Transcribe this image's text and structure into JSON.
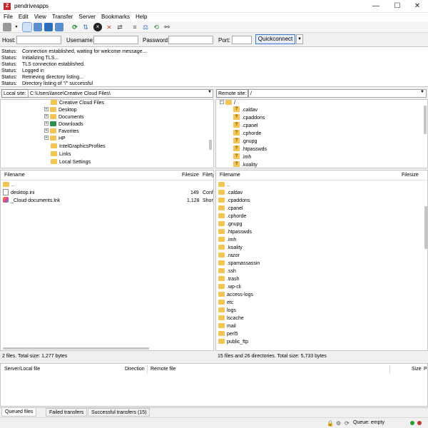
{
  "window": {
    "title": "pendriveapps",
    "app_icon": "filezilla-icon",
    "minimize": "—",
    "maximize": "☐",
    "close": "✕"
  },
  "menu": [
    "File",
    "Edit",
    "View",
    "Transfer",
    "Server",
    "Bookmarks",
    "Help"
  ],
  "toolbar": {
    "icons": [
      "site-manager-icon",
      "toggle-log-icon",
      "toggle-local-tree-icon",
      "toggle-remote-tree-icon",
      "toggle-queue-icon",
      "refresh-icon",
      "process-queue-icon",
      "cancel-icon",
      "disconnect-icon",
      "reconnect-icon",
      "directory-filter-icon",
      "compare-icon",
      "sync-browse-icon",
      "search-icon",
      "binoculars-icon"
    ]
  },
  "quickconnect": {
    "host_label": "Host:",
    "username_label": "Username:",
    "password_label": "Password:",
    "port_label": "Port:",
    "host_value": "",
    "username_value": "",
    "password_value": "",
    "port_value": "",
    "button_label": "Quickconnect",
    "dropdown": "▼"
  },
  "log": [
    {
      "key": "Status:",
      "text": "Connection established, waiting for welcome message..."
    },
    {
      "key": "Status:",
      "text": "Initializing TLS..."
    },
    {
      "key": "Status:",
      "text": "TLS connection established."
    },
    {
      "key": "Status:",
      "text": "Logged in"
    },
    {
      "key": "Status:",
      "text": "Retrieving directory listing..."
    },
    {
      "key": "Status:",
      "text": "Directory listing of \"/\" successful"
    }
  ],
  "local_site": {
    "label": "Local site:",
    "path": "C:\\Users\\lance\\Creative Cloud Files\\",
    "tree": [
      "Creative Cloud Files",
      "Desktop",
      "Documents",
      "Downloads",
      "Favorites",
      "HP",
      "IntelGraphicsProfiles",
      "Links",
      "Local Settings"
    ],
    "columns": [
      "Filename",
      "Filesize",
      "Filety"
    ],
    "files": [
      {
        "name": "..",
        "size": "",
        "type": ""
      },
      {
        "name": "desktop.ini",
        "size": "149",
        "type": "Conf"
      },
      {
        "name": "_Cloud documents.lnk",
        "size": "1,128",
        "type": "Short"
      }
    ],
    "status": "2 files. Total size: 1,277 bytes"
  },
  "remote_site": {
    "label": "Remote site:",
    "path": "/",
    "tree_root": "/",
    "tree": [
      ".caldav",
      ".cpaddons",
      ".cpanel",
      ".cphorde",
      ".gnupg",
      ".htpasswds",
      ".imh",
      ".koality"
    ],
    "columns": [
      "Filename",
      "Filesize"
    ],
    "files": [
      "..",
      ".caldav",
      ".cpaddons",
      ".cpanel",
      ".cphorde",
      ".gnupg",
      ".htpasswds",
      ".imh",
      ".koality",
      ".razor",
      ".spamassassin",
      ".ssh",
      ".trash",
      ".wp-cli",
      "access-logs",
      "etc",
      "logs",
      "lscache",
      "mail",
      "perl5",
      "public_ftp"
    ],
    "status": "15 files and 26 directories. Total size: 5,733 bytes"
  },
  "queue": {
    "columns": [
      "Server/Local file",
      "Direction",
      "Remote file",
      "Size",
      "P"
    ]
  },
  "tabs": [
    "Queued files",
    "Failed transfers",
    "Successful transfers (15)"
  ],
  "statusbar": {
    "queue_text": "Queue: empty",
    "icons": [
      "lock-icon",
      "gear-icon",
      "sync-icon"
    ]
  }
}
